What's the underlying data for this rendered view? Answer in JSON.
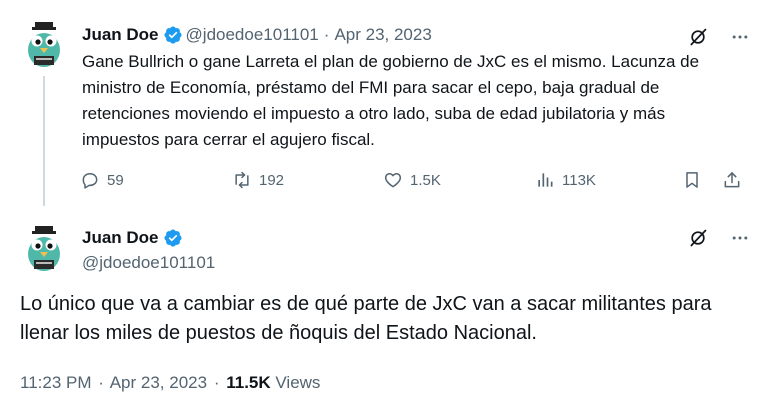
{
  "tweet1": {
    "name": "Juan Doe",
    "handle": "@jdoedoe101101",
    "separator": "·",
    "date": "Apr 23, 2023",
    "text": "Gane Bullrich o gane Larreta el plan de gobierno de JxC es el mismo. Lacunza de ministro de Economía, préstamo del FMI para sacar el cepo, baja gradual de retenciones moviendo el impuesto a otro lado, suba de edad jubilatoria y más impuestos para cerrar el agujero fiscal.",
    "replies": "59",
    "reposts": "192",
    "likes": "1.5K",
    "views": "113K"
  },
  "tweet2": {
    "name": "Juan Doe",
    "handle": "@jdoedoe101101",
    "text": "Lo único que va a cambiar es de qué parte de JxC van a sacar militantes para llenar los miles de puestos de ñoquis del Estado Nacional.",
    "time": "11:23 PM",
    "separator": "·",
    "date": "Apr 23, 2023",
    "separator2": "·",
    "views_count": "11.5K",
    "views_label": "Views"
  },
  "colors": {
    "verified": "#1d9bf0",
    "secondary_text": "#536471",
    "primary_text": "#0f1419",
    "avatar_bird": "#4fb8a8"
  },
  "icons": [
    "verified-icon",
    "grok-icon",
    "more-icon",
    "reply-icon",
    "repost-icon",
    "like-icon",
    "views-icon",
    "bookmark-icon",
    "share-icon"
  ]
}
